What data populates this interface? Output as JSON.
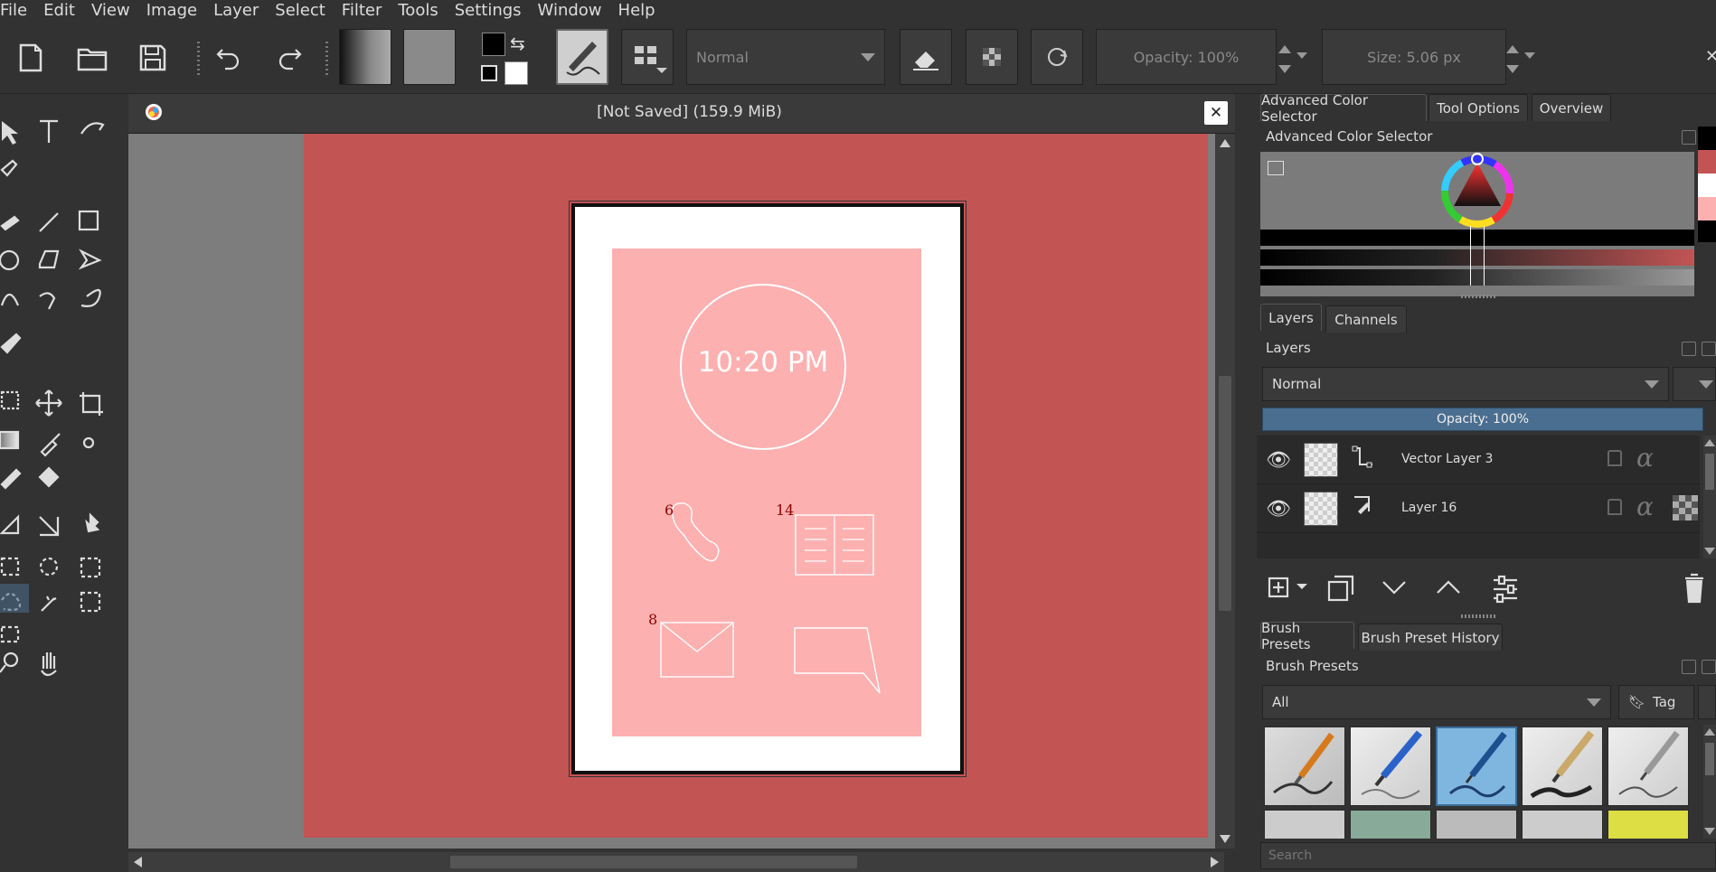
{
  "menu": [
    "File",
    "Edit",
    "View",
    "Image",
    "Layer",
    "Select",
    "Filter",
    "Tools",
    "Settings",
    "Window",
    "Help"
  ],
  "toolbar": {
    "blend_mode": "Normal",
    "opacity": "Opacity:  100%",
    "size": "Size:  5.06 px"
  },
  "document": {
    "title": "[Not Saved]  (159.9 MiB)",
    "artwork": {
      "clock_time": "10:20 PM",
      "phone_badge": "6",
      "book_badge": "14",
      "mail_badge": "8"
    }
  },
  "dock": {
    "top_tabs": [
      "Advanced Color Selector",
      "Tool Options",
      "Overview"
    ],
    "color_selector_title": "Advanced Color Selector",
    "layers_tabs": [
      "Layers",
      "Channels"
    ],
    "layers_title": "Layers",
    "layers_blend": "Normal",
    "layers_opacity": "Opacity:  100%",
    "layers": [
      {
        "name": "Vector Layer 3"
      },
      {
        "name": "Layer 16"
      }
    ],
    "brush_tabs": [
      "Brush Presets",
      "Brush Preset History"
    ],
    "brush_title": "Brush Presets",
    "brush_filter": "All",
    "tag_label": "Tag",
    "search_placeholder": "Search"
  },
  "colors": {
    "canvas_bg": "#c25454",
    "paper_pink": "#fdb0b0",
    "badge_red": "#8b0000",
    "swatches": [
      "#000000",
      "#c25454",
      "#ffffff",
      "#fdb0b0",
      "#000000"
    ]
  }
}
